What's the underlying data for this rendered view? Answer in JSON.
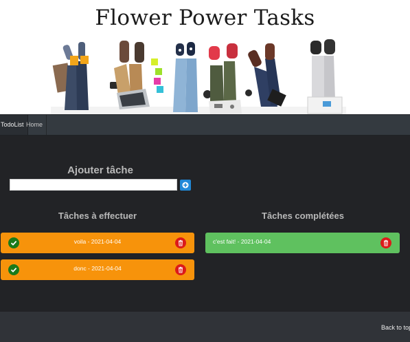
{
  "site": {
    "title": "Flower Power Tasks"
  },
  "navbar": {
    "brand": "TodoList",
    "links": [
      {
        "label": "Home"
      }
    ]
  },
  "add_task": {
    "title": "Ajouter tâche",
    "input_value": "",
    "input_placeholder": ""
  },
  "todo": {
    "title": "Tâches à effectuer",
    "tasks": [
      {
        "text": "voila - 2021-04-04"
      },
      {
        "text": "donc - 2021-04-04"
      }
    ]
  },
  "done": {
    "title": "Tâches complétées",
    "tasks": [
      {
        "text": "c'est fait! - 2021-04-04"
      }
    ]
  },
  "footer": {
    "back_to_top": "Back to top"
  },
  "colors": {
    "navbar": "#343a40",
    "main_bg": "#222326",
    "todo_card": "#f7930b",
    "done_card": "#5fc15f",
    "check_button": "#1a7a1a",
    "delete_button": "#dc1a1a",
    "add_button": "#2189d8"
  },
  "icons": {
    "add": "plus-circle-icon",
    "check": "check-icon",
    "delete": "trash-icon"
  }
}
